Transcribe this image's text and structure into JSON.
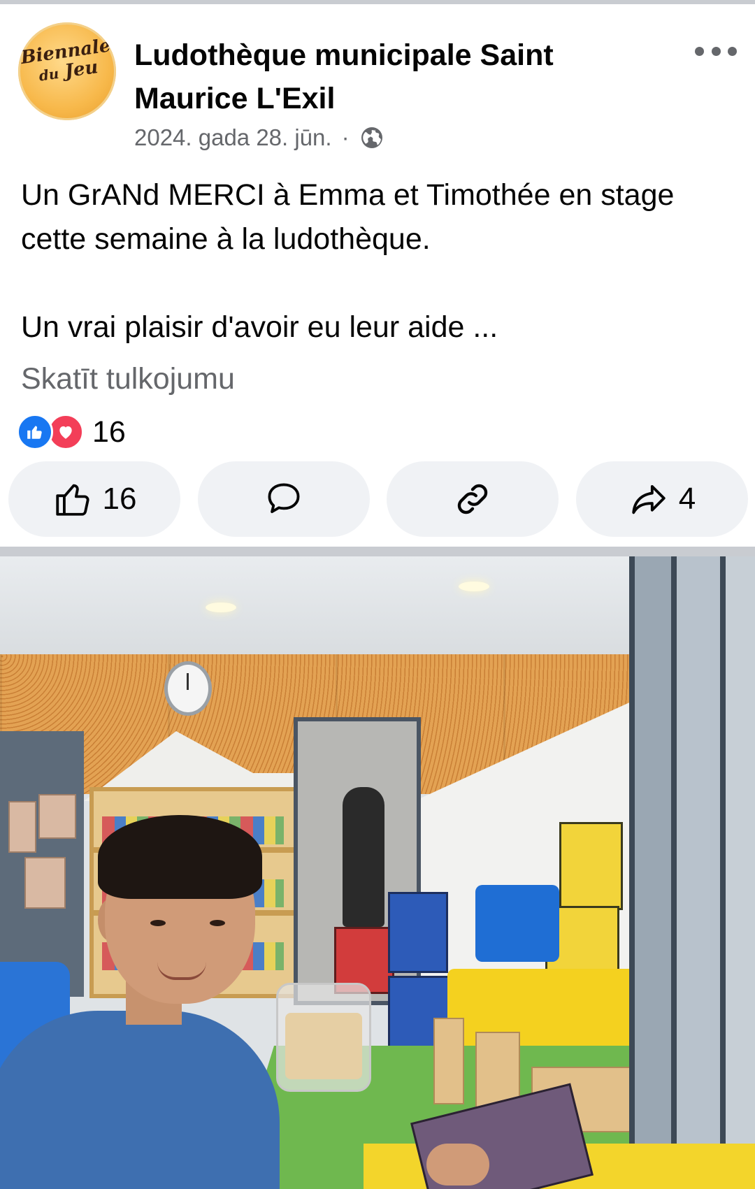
{
  "post": {
    "page_name": "Ludothèque municipale Saint Maurice L'Exil",
    "avatar_logo_text": "Biennale du Jeu",
    "date": "2024. gada 28. jūn.",
    "meta_separator": "·",
    "text_line1": "Un GrANd MERCI à Emma et Timothée en stage cette semaine à la ludothèque.",
    "text_line2": "Un vrai plaisir d'avoir eu leur aide ...",
    "see_translation": "Skatīt tulkojumu"
  },
  "reactions": {
    "types": [
      "like",
      "love"
    ],
    "count": "16"
  },
  "actions": {
    "like_count": "16",
    "share_count": "4"
  },
  "icons": {
    "more": "more-horizontal-icon",
    "audience": "globe-icon",
    "like": "thumbs-up-icon",
    "comment": "comment-bubble-icon",
    "link": "link-icon",
    "share": "share-arrow-icon"
  },
  "colors": {
    "like_blue": "#1877f2",
    "love_red": "#f33e58",
    "secondary_text": "#65676b",
    "button_bg": "#f0f2f5"
  }
}
